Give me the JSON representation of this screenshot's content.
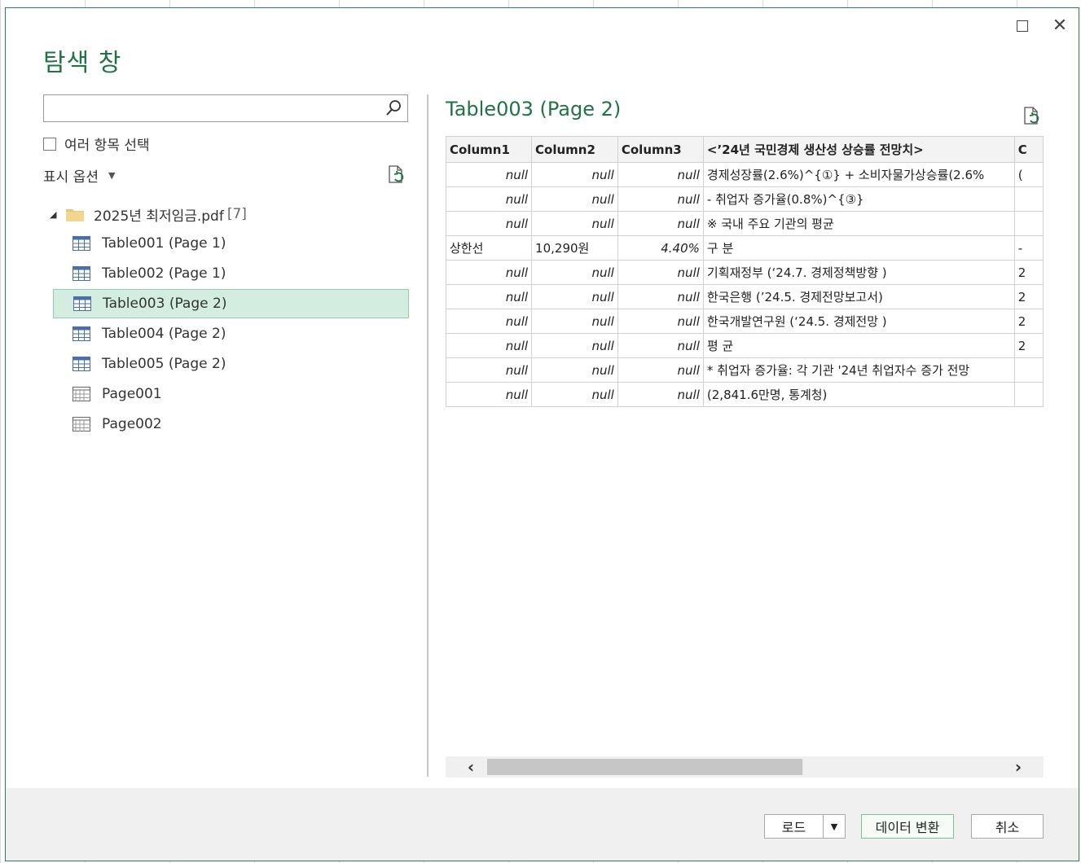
{
  "dialog": {
    "title": "탐색 창"
  },
  "left": {
    "search_value": "",
    "multi_select_label": "여러 항목 선택",
    "display_options_label": "표시 옵션",
    "tree_root": {
      "label": "2025년 최저임금.pdf",
      "count": "[7]"
    },
    "items": [
      {
        "label": "Table001 (Page 1)",
        "type": "table"
      },
      {
        "label": "Table002 (Page 1)",
        "type": "table"
      },
      {
        "label": "Table003 (Page 2)",
        "type": "table",
        "selected": true
      },
      {
        "label": "Table004 (Page 2)",
        "type": "table"
      },
      {
        "label": "Table005 (Page 2)",
        "type": "table"
      },
      {
        "label": "Page001",
        "type": "page"
      },
      {
        "label": "Page002",
        "type": "page"
      }
    ]
  },
  "preview": {
    "title": "Table003 (Page 2)",
    "columns": [
      "Column1",
      "Column2",
      "Column3",
      "<’24년 국민경제 생산성 상승률 전망치>",
      "C"
    ],
    "rows": [
      [
        "null",
        "null",
        "null",
        "경제성장률(2.6%)^{①} + 소비자물가상승률(2.6%",
        "("
      ],
      [
        "null",
        "null",
        "null",
        "- 취업자 증가율(0.8%)^{③}",
        ""
      ],
      [
        "null",
        "null",
        "null",
        "※ 국내 주요 기관의 평균",
        ""
      ],
      [
        "상한선",
        "10,290원",
        "4.40%",
        "구 분",
        "-"
      ],
      [
        "null",
        "null",
        "null",
        "기획재정부 (‘24.7. 경제정책방향 )",
        "2"
      ],
      [
        "null",
        "null",
        "null",
        "한국은행 (’24.5. 경제전망보고서)",
        "2"
      ],
      [
        "null",
        "null",
        "null",
        "한국개발연구원 (‘24.5. 경제전망 )",
        "2"
      ],
      [
        "null",
        "null",
        "null",
        "평 균",
        "2"
      ],
      [
        "null",
        "null",
        "null",
        "* 취업자 증가율: 각 기관 '24년 취업자수 증가 전망",
        ""
      ],
      [
        "null",
        "null",
        "null",
        "(2,841.6만명, 통계청)",
        ""
      ]
    ]
  },
  "footer": {
    "load_label": "로드",
    "transform_label": "데이터 변환",
    "cancel_label": "취소"
  },
  "icons": {
    "search": "search-icon",
    "refresh": "refresh-icon",
    "folder": "folder-icon",
    "table": "table-icon",
    "page": "page-icon"
  }
}
